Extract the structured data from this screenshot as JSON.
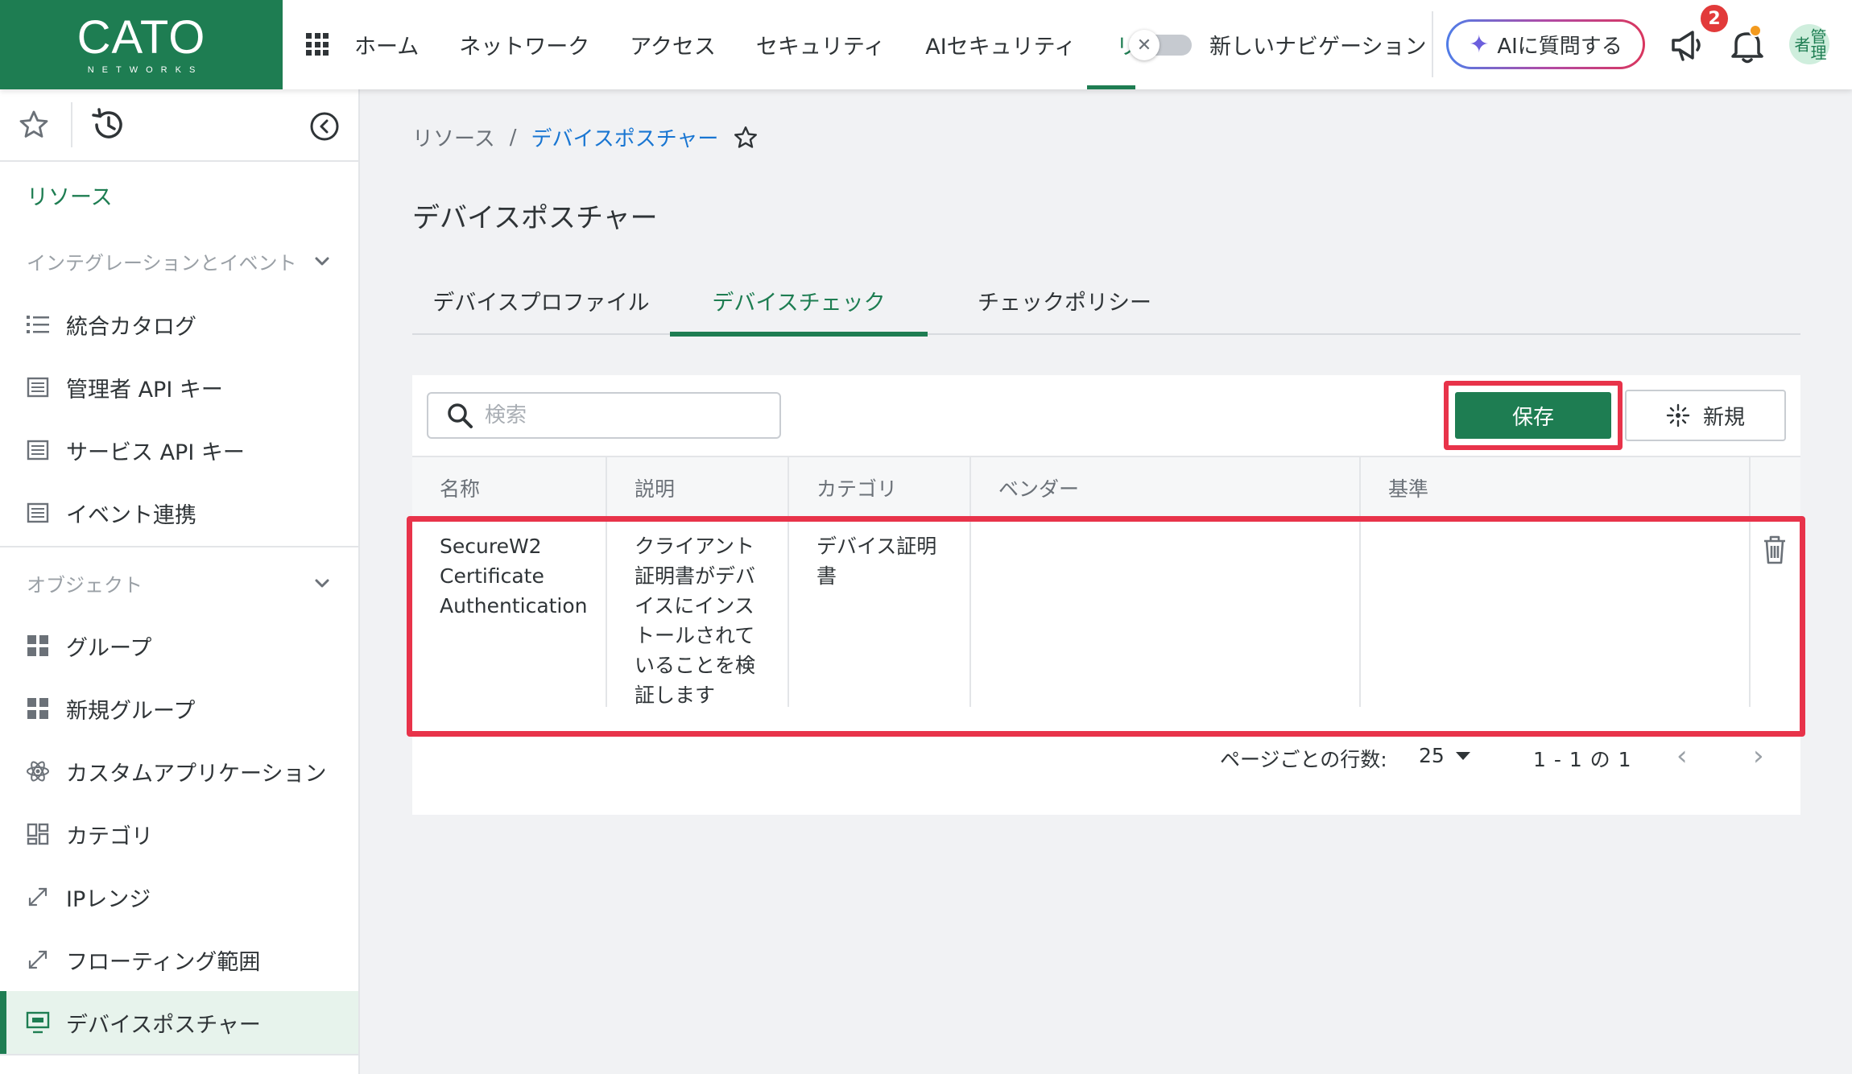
{
  "brand": {
    "name": "CATO",
    "sub": "NETWORKS",
    "color": "#1e7d52"
  },
  "topnav": {
    "items": [
      "ホーム",
      "ネットワーク",
      "アクセス",
      "セキュリティ",
      "AIセキュリティ"
    ],
    "clipped_item": "リソース",
    "toggle_label": "新しいナビゲーション",
    "toggle_on": false,
    "ai_button": "AIに質問する",
    "notification_count": "2",
    "avatar_text": "管理者"
  },
  "sidebar": {
    "section_title": "リソース",
    "group1": {
      "label": "インテグレーションとイベント",
      "items": [
        "統合カタログ",
        "管理者 API キー",
        "サービス API キー",
        "イベント連携"
      ]
    },
    "group2": {
      "label": "オブジェクト",
      "items": [
        "グループ",
        "新規グループ",
        "カスタムアプリケーション",
        "カテゴリ",
        "IPレンジ",
        "フローティング範囲",
        "デバイスポスチャー"
      ]
    },
    "active_item": "デバイスポスチャー"
  },
  "breadcrumb": {
    "parent": "リソース",
    "separator": "/",
    "current": "デバイスポスチャー"
  },
  "page_title": "デバイスポスチャー",
  "tabs": [
    "デバイスプロファイル",
    "デバイスチェック",
    "チェックポリシー"
  ],
  "active_tab": "デバイスチェック",
  "toolbar": {
    "search_placeholder": "検索",
    "save_label": "保存",
    "new_label": "新規"
  },
  "table": {
    "columns": [
      "名称",
      "説明",
      "カテゴリ",
      "ベンダー",
      "基準"
    ],
    "rows": [
      {
        "name_lines": [
          "SecureW2",
          "Certificate",
          "Authentication"
        ],
        "description_lines": [
          "クライアント",
          "証明書がデバ",
          "イスにインス",
          "トールされて",
          "いることを検",
          "証します"
        ],
        "category_lines": [
          "デバイス証明",
          "書"
        ],
        "vendor": "",
        "criteria": ""
      }
    ]
  },
  "pagination": {
    "rows_label": "ページごとの行数:",
    "rows_per_page": "25",
    "range": "1 - 1 の 1"
  },
  "colors": {
    "accent": "#1e7d52",
    "highlight": "#e8334a",
    "link": "#1976d2"
  }
}
